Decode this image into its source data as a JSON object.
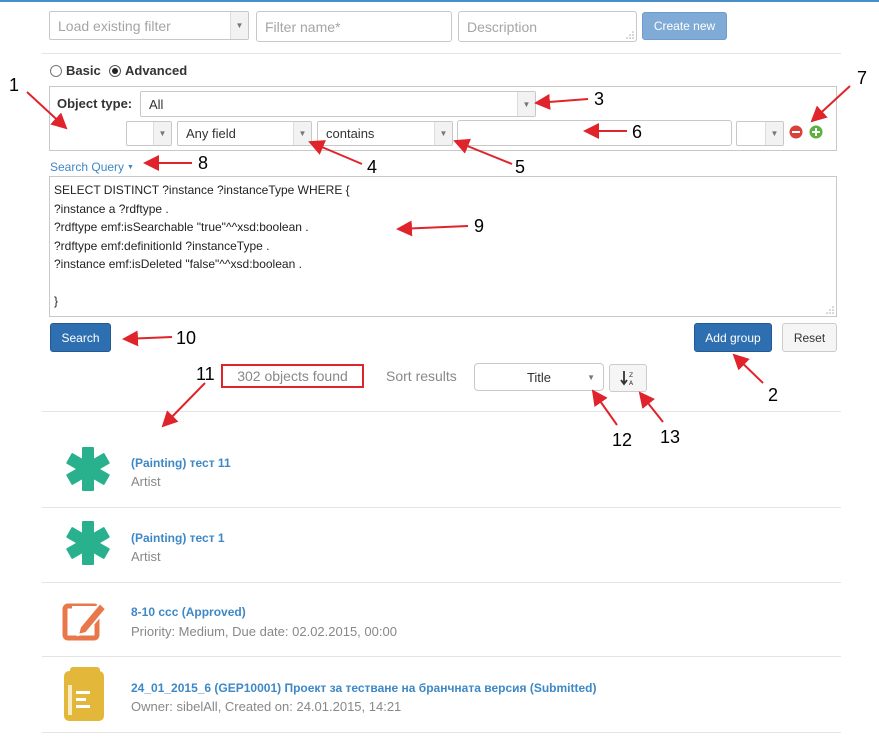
{
  "filter": {
    "load_placeholder": "Load existing filter",
    "name_placeholder": "Filter name*",
    "description_placeholder": "Description",
    "create_new_label": "Create new"
  },
  "mode": {
    "basic_label": "Basic",
    "advanced_label": "Advanced",
    "selected": "Advanced"
  },
  "criteria": {
    "object_type_label": "Object type:",
    "object_type_value": "All",
    "field_value": "Any field",
    "operator_value": "contains",
    "value_text": ""
  },
  "search_query": {
    "toggle_label": "Search Query",
    "lines": [
      "SELECT DISTINCT ?instance ?instanceType WHERE {",
      "?instance a ?rdftype .",
      "?rdftype emf:isSearchable \"true\"^^xsd:boolean .",
      "?rdftype emf:definitionId ?instanceType .",
      "?instance emf:isDeleted \"false\"^^xsd:boolean .",
      "",
      "}"
    ]
  },
  "buttons": {
    "search": "Search",
    "add_group": "Add group",
    "reset": "Reset"
  },
  "results": {
    "count_text": "302 objects found",
    "sort_label": "Sort results",
    "sort_value": "Title",
    "items": [
      {
        "title": "(Painting) тест 11",
        "subtitle": "Artist",
        "icon": "asterisk-icon"
      },
      {
        "title": "(Painting) тест 1",
        "subtitle": "Artist",
        "icon": "asterisk-icon"
      },
      {
        "title": "8-10 ccc (Approved)",
        "subtitle": "Priority: Medium, Due date: 02.02.2015, 00:00",
        "icon": "edit-task-icon"
      },
      {
        "title": "24_01_2015_6 (GEP10001) Проект за тестване на бранчната версия (Submitted)",
        "subtitle": "Owner: sibelAll, Created on: 24.01.2015, 14:21",
        "icon": "document-folder-icon"
      }
    ]
  },
  "annotations": [
    "1",
    "2",
    "3",
    "4",
    "5",
    "6",
    "7",
    "8",
    "9",
    "10",
    "11",
    "12",
    "13"
  ],
  "colors": {
    "link": "#3d88c6",
    "primary_button": "#2e6fb2",
    "annotation_red": "#e0242b",
    "asterisk_teal": "#29b08c",
    "edit_orange": "#e8784a",
    "doc_yellow": "#e3b73a"
  }
}
